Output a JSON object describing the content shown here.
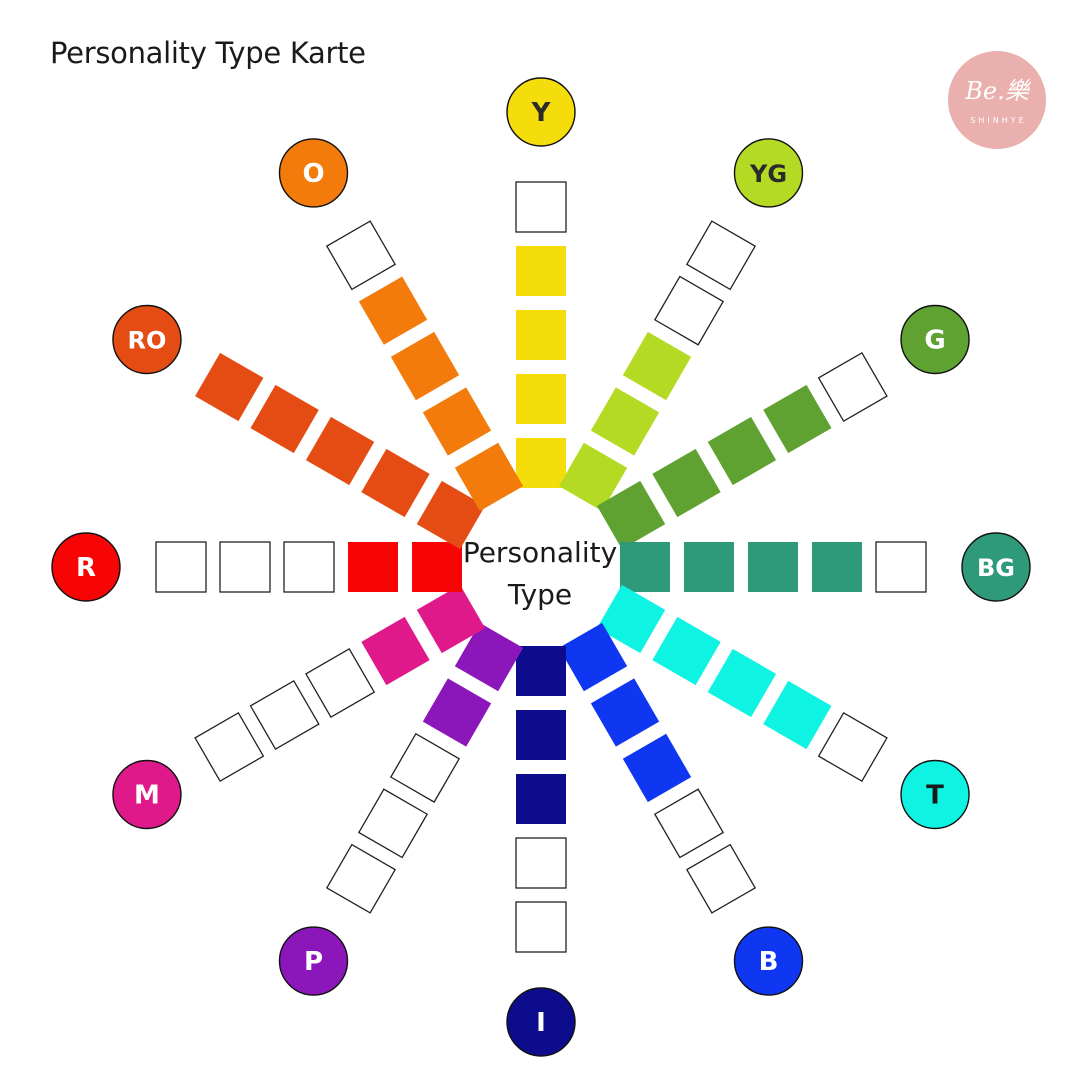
{
  "title": "Personality Type Karte",
  "logo": {
    "mark": "Be.樂",
    "subtitle": "SHINHYE",
    "color": "#eab0ae"
  },
  "center_label": "Personality\nType",
  "spokes": [
    {
      "label": "Y",
      "color": "#f5dd0c",
      "label_color": "#2a2a2a",
      "filled": 4
    },
    {
      "label": "YG",
      "color": "#b5da24",
      "label_color": "#2a2a2a",
      "filled": 3
    },
    {
      "label": "G",
      "color": "#5fa232",
      "label_color": "#ffffff",
      "filled": 4
    },
    {
      "label": "BG",
      "color": "#2e9a7a",
      "label_color": "#ffffff",
      "filled": 4
    },
    {
      "label": "T",
      "color": "#0ff3e3",
      "label_color": "#1a1a1a",
      "filled": 4
    },
    {
      "label": "B",
      "color": "#0f36f0",
      "label_color": "#ffffff",
      "filled": 3
    },
    {
      "label": "I",
      "color": "#0c0c8c",
      "label_color": "#ffffff",
      "filled": 3
    },
    {
      "label": "P",
      "color": "#8b16b9",
      "label_color": "#ffffff",
      "filled": 2
    },
    {
      "label": "M",
      "color": "#e0198b",
      "label_color": "#ffffff",
      "filled": 2
    },
    {
      "label": "R",
      "color": "#f70505",
      "label_color": "#ffffff",
      "filled": 2
    },
    {
      "label": "RO",
      "color": "#e44c14",
      "label_color": "#ffffff",
      "filled": 5
    },
    {
      "label": "O",
      "color": "#f27b0b",
      "label_color": "#ffffff",
      "filled": 4
    }
  ]
}
